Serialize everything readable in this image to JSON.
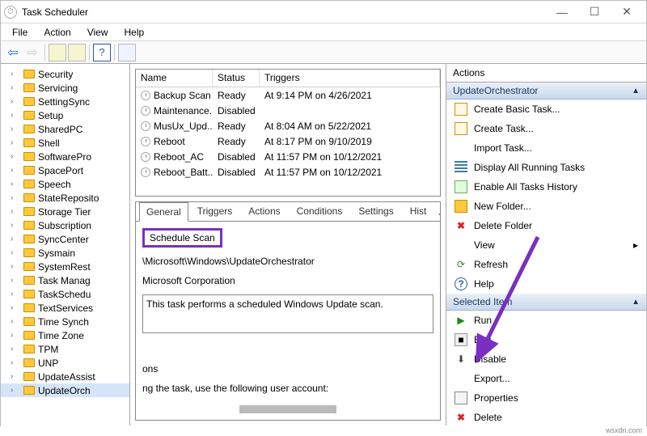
{
  "window": {
    "title": "Task Scheduler"
  },
  "menubar": [
    "File",
    "Action",
    "View",
    "Help"
  ],
  "tree": [
    "Security",
    "Servicing",
    "SettingSync",
    "Setup",
    "SharedPC",
    "Shell",
    "SoftwarePro",
    "SpacePort",
    "Speech",
    "StateReposito",
    "Storage Tier",
    "Subscription",
    "SyncCenter",
    "Sysmain",
    "SystemRest",
    "Task Manag",
    "TaskSchedu",
    "TextServices",
    "Time Synch",
    "Time Zone",
    "TPM",
    "UNP",
    "UpdateAssist",
    "UpdateOrch"
  ],
  "tree_selected_index": 23,
  "task_columns": [
    "Name",
    "Status",
    "Triggers"
  ],
  "tasks": [
    {
      "name": "Backup Scan",
      "status": "Ready",
      "trigger": "At 9:14 PM on 4/26/2021"
    },
    {
      "name": "Maintenance...",
      "status": "Disabled",
      "trigger": ""
    },
    {
      "name": "MusUx_Upd...",
      "status": "Ready",
      "trigger": "At 8:04 AM on 5/22/2021"
    },
    {
      "name": "Reboot",
      "status": "Ready",
      "trigger": "At 8:17 PM on 9/10/2019"
    },
    {
      "name": "Reboot_AC",
      "status": "Disabled",
      "trigger": "At 11:57 PM on 10/12/2021"
    },
    {
      "name": "Reboot_Batt...",
      "status": "Disabled",
      "trigger": "At 11:57 PM on 10/12/2021"
    }
  ],
  "detail_tabs": [
    "General",
    "Triggers",
    "Actions",
    "Conditions",
    "Settings",
    "Hist"
  ],
  "detail": {
    "task_name": "Schedule Scan",
    "location": "\\Microsoft\\Windows\\UpdateOrchestrator",
    "author": "Microsoft Corporation",
    "description": "This task performs a scheduled Windows Update scan.",
    "extra1": "ons",
    "extra2": "ng the task, use the following user account:"
  },
  "actions": {
    "title": "Actions",
    "section1": "UpdateOrchestrator",
    "group1": [
      {
        "icon": "create-basic",
        "label": "Create Basic Task..."
      },
      {
        "icon": "create",
        "label": "Create Task..."
      },
      {
        "icon": "import",
        "label": "Import Task..."
      },
      {
        "icon": "display",
        "label": "Display All Running Tasks"
      },
      {
        "icon": "history",
        "label": "Enable All Tasks History"
      },
      {
        "icon": "newfolder",
        "label": "New Folder..."
      },
      {
        "icon": "delete",
        "label": "Delete Folder"
      },
      {
        "icon": "view",
        "label": "View",
        "hasSubmenu": true
      },
      {
        "icon": "refresh",
        "label": "Refresh"
      },
      {
        "icon": "help",
        "label": "Help"
      }
    ],
    "section2": "Selected Item",
    "group2": [
      {
        "icon": "run",
        "label": "Run"
      },
      {
        "icon": "end",
        "label": "End"
      },
      {
        "icon": "disable",
        "label": "Disable"
      },
      {
        "icon": "export",
        "label": "Export..."
      },
      {
        "icon": "props",
        "label": "Properties"
      },
      {
        "icon": "delete2",
        "label": "Delete"
      }
    ]
  },
  "watermark": "wsxdn.com"
}
